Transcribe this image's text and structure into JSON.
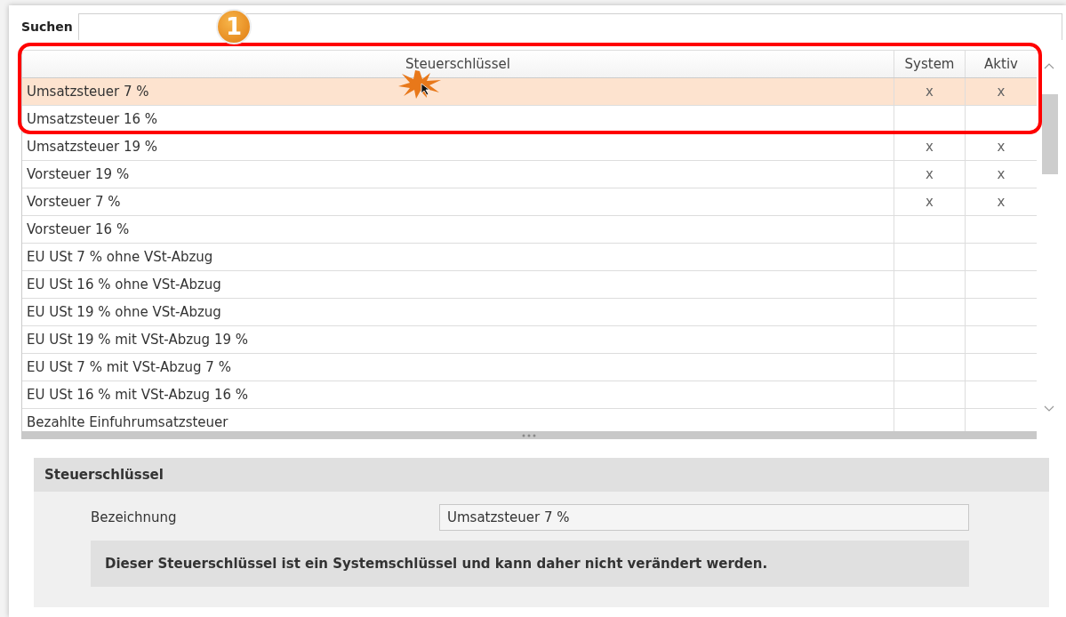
{
  "search": {
    "label": "Suchen"
  },
  "callout": {
    "label": "1"
  },
  "table": {
    "columns": [
      "Steuerschlüssel",
      "System",
      "Aktiv"
    ],
    "rows": [
      {
        "name": "Umsatzsteuer 7 %",
        "system": "x",
        "active": "x",
        "selected": true
      },
      {
        "name": "Umsatzsteuer 16 %",
        "selected": false
      },
      {
        "name": "Umsatzsteuer 19 %",
        "system": "x",
        "active": "x",
        "selected": false
      },
      {
        "name": "Vorsteuer 19 %",
        "system": "x",
        "active": "x",
        "selected": false
      },
      {
        "name": "Vorsteuer 7 %",
        "system": "x",
        "active": "x",
        "selected": false
      },
      {
        "name": "Vorsteuer 16 %",
        "selected": false
      },
      {
        "name": "EU USt 7 % ohne VSt-Abzug",
        "selected": false
      },
      {
        "name": "EU USt 16 % ohne VSt-Abzug",
        "selected": false
      },
      {
        "name": "EU USt 19 % ohne VSt-Abzug",
        "selected": false
      },
      {
        "name": "EU USt 19 % mit VSt-Abzug 19 %",
        "selected": false
      },
      {
        "name": "EU USt 7 % mit VSt-Abzug 7 %",
        "selected": false
      },
      {
        "name": "EU USt 16 % mit VSt-Abzug 16 %",
        "selected": false
      },
      {
        "name": "Bezahlte Einfuhrumsatzsteuer",
        "selected": false
      }
    ]
  },
  "detail": {
    "title": "Steuerschlüssel",
    "field_label": "Bezeichnung",
    "field_value": "Umsatzsteuer 7 %",
    "notice": "Dieser Steuerschlüssel ist ein Systemschlüssel und kann daher nicht verändert werden."
  }
}
